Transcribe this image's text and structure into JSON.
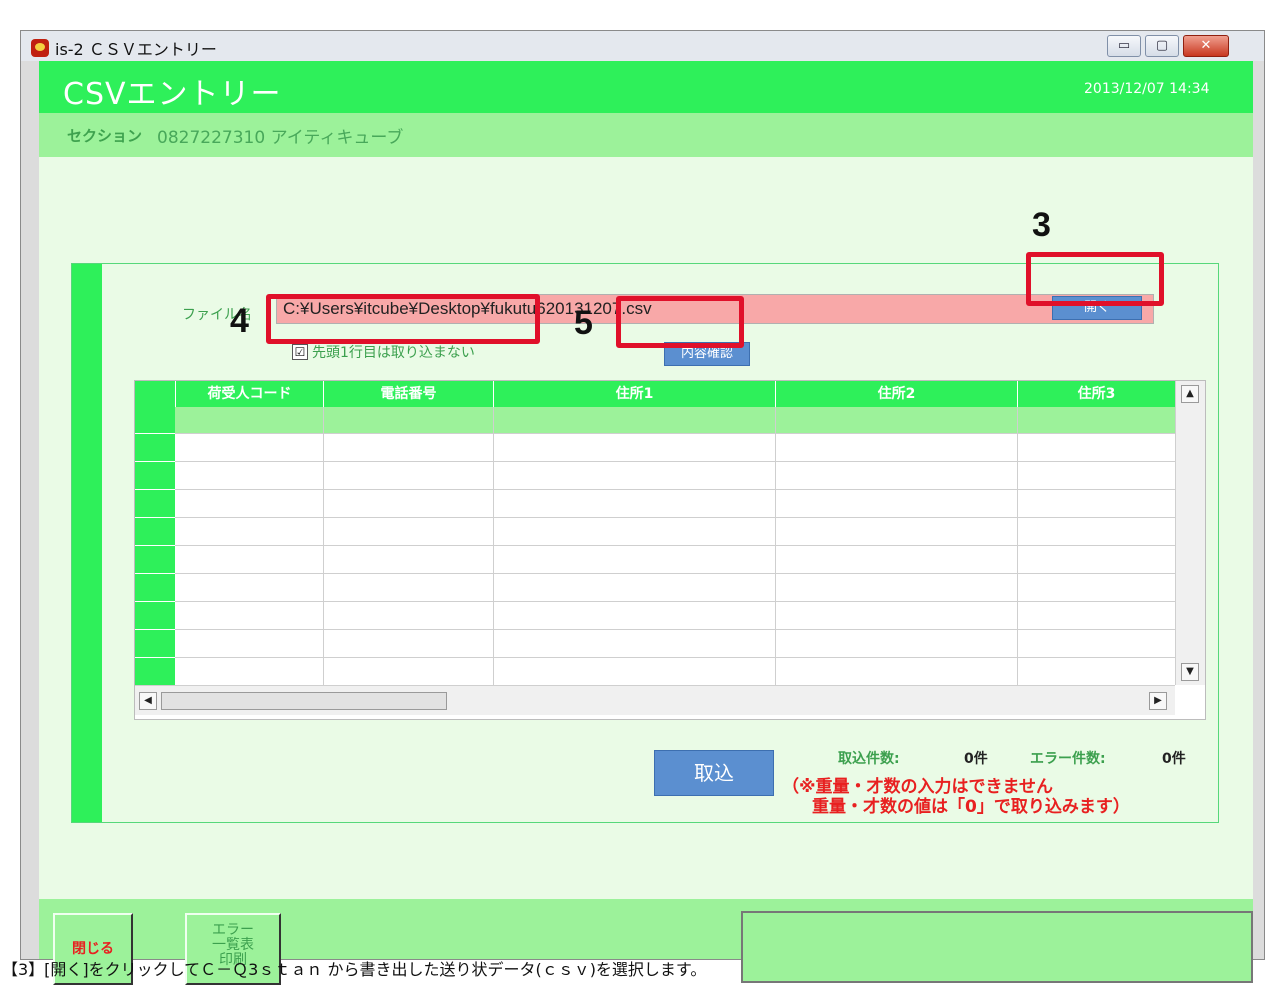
{
  "window": {
    "title": "is-2 ＣＳＶエントリー",
    "minimize": "▭",
    "maximize": "▢",
    "close": "✕"
  },
  "header": {
    "title": "CSVエントリー",
    "datetime": "2013/12/07 14:34"
  },
  "section": {
    "label": "セクション",
    "value": "0827227310 アイティキューブ"
  },
  "file": {
    "label": "ファイル名",
    "path": "C:¥Users¥itcube¥Desktop¥fukutu620131207.csv",
    "open_button": "開く"
  },
  "options": {
    "skip_header_checked": "☑",
    "skip_header_label": "先頭1行目は取り込まない",
    "confirm_button": "内容確認"
  },
  "grid": {
    "columns": [
      "荷受人コード",
      "電話番号",
      "住所1",
      "住所2",
      "住所3"
    ],
    "scroll_up": "▲",
    "scroll_down": "▼",
    "scroll_left": "◀",
    "scroll_right": "▶"
  },
  "import": {
    "button": "取込",
    "imported_label": "取込件数:",
    "imported_value": "0件",
    "error_label": "エラー件数:",
    "error_value": "0件",
    "note_line1": "（※重量・才数の入力はできません",
    "note_line2": "重量・才数の値は「0」で取り込みます）"
  },
  "footer": {
    "close_button": "閉じる",
    "error_print_line1": "エラー",
    "error_print_line2": "一覧表",
    "error_print_line3": "印刷"
  },
  "markers": {
    "m3": "3",
    "m4": "4",
    "m5": "5"
  },
  "caption": "【3】[開く]をクリックしてＣ－Ｑ3ｓｔａｎ から書き出した送り状データ(ｃｓｖ)を選択します。",
  "colors": {
    "brand_green": "#2ef05a",
    "light_green": "#9cf29a",
    "button_blue": "#5b8fd0",
    "annotation_red": "#e0102a"
  }
}
